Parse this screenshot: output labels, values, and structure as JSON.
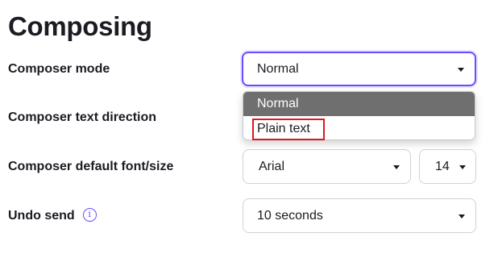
{
  "section": {
    "title": "Composing"
  },
  "settings": {
    "composer_mode": {
      "label": "Composer mode",
      "value": "Normal"
    },
    "text_direction": {
      "label": "Composer text direction"
    },
    "default_font": {
      "label": "Composer default font/size",
      "font": "Arial",
      "size": "14"
    },
    "undo_send": {
      "label": "Undo send",
      "info_glyph": "i",
      "value": "10 seconds"
    }
  },
  "dropdown": {
    "options": [
      "Normal",
      "Plain text"
    ],
    "selected": "Normal",
    "highlighted": "Plain text"
  },
  "colors": {
    "accent": "#6d4aff",
    "selected_option_bg": "#6f6f6f",
    "annotation": "#e0181e"
  },
  "icons": {
    "caret": "chevron-down-icon",
    "info": "info-icon"
  }
}
